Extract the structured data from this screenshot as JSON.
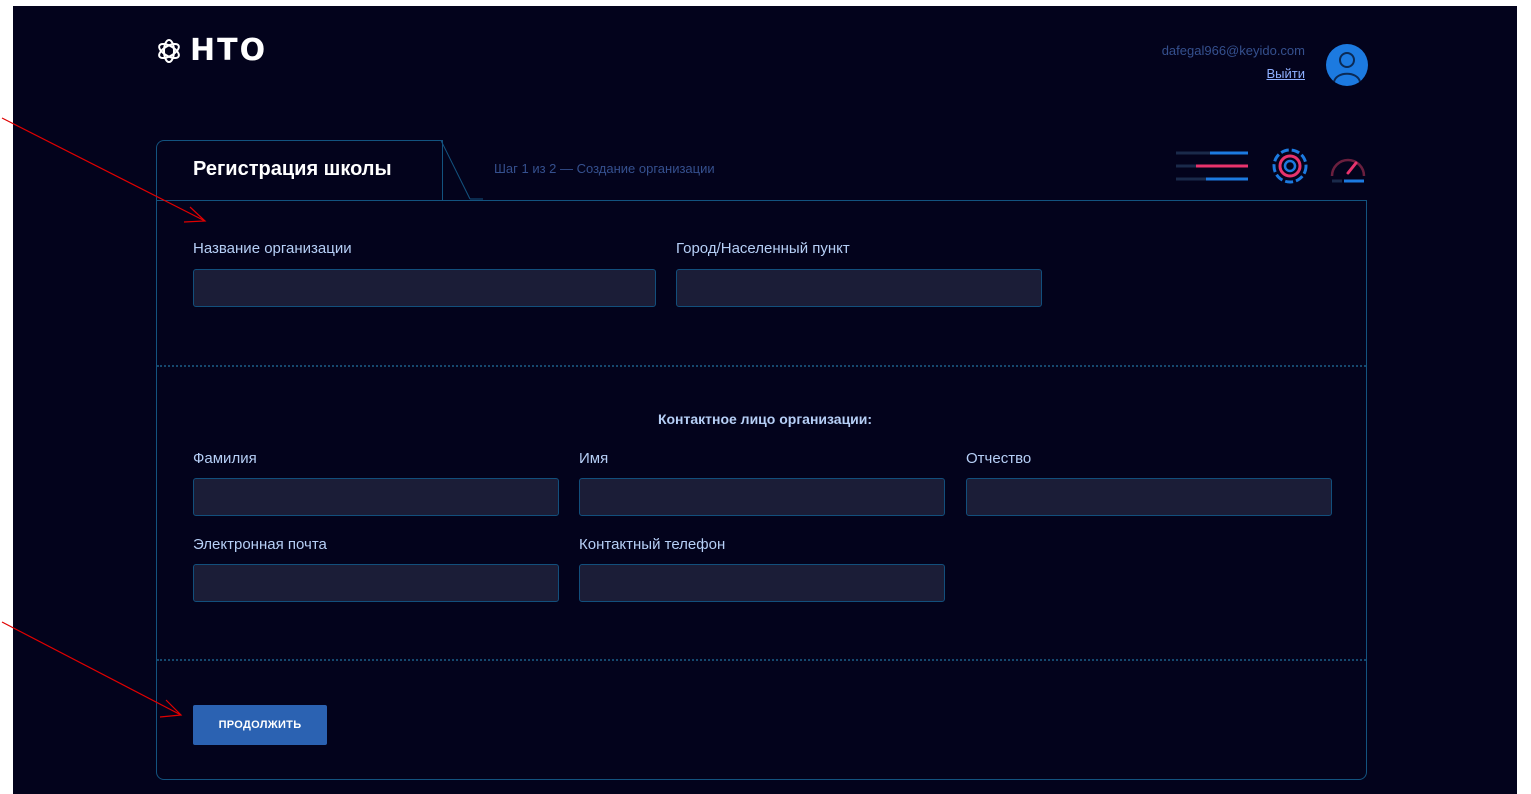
{
  "header": {
    "logo_text": "НТО",
    "user_email": "dafegal966@keyido.com",
    "logout_label": "Выйти"
  },
  "registration": {
    "tab_title": "Регистрация школы",
    "step_text": "Шаг 1 из 2 — Создание организации"
  },
  "org_fields": {
    "name_label": "Название организации",
    "name_value": "",
    "city_label": "Город/Населенный пункт",
    "city_value": ""
  },
  "contact": {
    "section_title": "Контактное лицо организации:",
    "last_name_label": "Фамилия",
    "first_name_label": "Имя",
    "middle_name_label": "Отчество",
    "email_label": "Электронная почта",
    "phone_label": "Контактный телефон"
  },
  "actions": {
    "continue_label": "ПРОДОЛЖИТЬ"
  },
  "toolbar": {
    "icons": [
      "sliders-icon",
      "target-icon",
      "speedometer-icon"
    ]
  },
  "colors": {
    "background": "#03031c",
    "border": "#13537f",
    "input_bg": "#1b1d37",
    "label": "#b6cff6",
    "button": "#2b62b2",
    "accent_pink": "#e8336d",
    "accent_blue": "#1c7ae0",
    "annotation_arrow": "#e00000"
  }
}
